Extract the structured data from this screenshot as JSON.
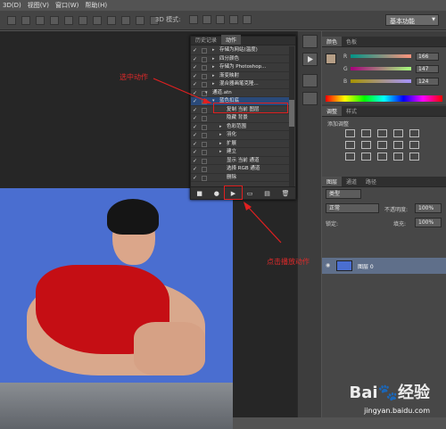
{
  "menubar": {
    "items": [
      "3D(D)",
      "视图(V)",
      "窗口(W)",
      "帮助(H)"
    ]
  },
  "options": {
    "mode_3d_label": "3D 模式:",
    "workspace": "基本功能"
  },
  "actions_panel": {
    "tabs": [
      "历史记录",
      "动作"
    ],
    "rows": [
      {
        "checked": "✓",
        "indent": 0,
        "expand": "▸",
        "label": "存储为网站(温度)"
      },
      {
        "checked": "✓",
        "indent": 0,
        "expand": "▸",
        "label": "四分颜色"
      },
      {
        "checked": "✓",
        "indent": 0,
        "expand": "▸",
        "label": "存储为 Photoshop..."
      },
      {
        "checked": "✓",
        "indent": 0,
        "expand": "▸",
        "label": "渐变映射"
      },
      {
        "checked": "✓",
        "indent": 0,
        "expand": "▸",
        "label": "混合器画笔克隆..."
      },
      {
        "checked": "✓",
        "indent": -1,
        "expand": "▾",
        "label": "通道.atn"
      },
      {
        "checked": "✓",
        "indent": 0,
        "expand": "▾",
        "label": "蓝色扣底"
      },
      {
        "checked": "✓",
        "indent": 1,
        "expand": "",
        "label": "复制 当前 图层"
      },
      {
        "checked": "✓",
        "indent": 1,
        "expand": "",
        "label": "隐藏 背景"
      },
      {
        "checked": "✓",
        "indent": 1,
        "expand": "▸",
        "label": "色彩范围"
      },
      {
        "checked": "✓",
        "indent": 1,
        "expand": "▸",
        "label": "羽化"
      },
      {
        "checked": "✓",
        "indent": 1,
        "expand": "▸",
        "label": "扩展"
      },
      {
        "checked": "✓",
        "indent": 1,
        "expand": "▸",
        "label": "建立"
      },
      {
        "checked": "✓",
        "indent": 1,
        "expand": "",
        "label": "显示 当前 通道"
      },
      {
        "checked": "✓",
        "indent": 1,
        "expand": "",
        "label": "选择 RGB 通道"
      },
      {
        "checked": "✓",
        "indent": 1,
        "expand": "",
        "label": "删除"
      }
    ],
    "footer_buttons": [
      "■",
      "●",
      "▶",
      "▭",
      "▤",
      "🗑"
    ]
  },
  "color_panel": {
    "tabs": [
      "颜色",
      "色板"
    ],
    "r_label": "R",
    "r_value": "166",
    "g_label": "G",
    "g_value": "147",
    "b_label": "B",
    "b_value": "124",
    "fg_color": "#b59e86"
  },
  "adjust_panel": {
    "tabs": [
      "调整",
      "样式"
    ],
    "title": "添加调整"
  },
  "layers_panel": {
    "tabs": [
      "图层",
      "通道",
      "路径"
    ],
    "filter": "类型",
    "blend_mode": "正常",
    "opacity_label": "不透明度:",
    "opacity_value": "100%",
    "lock_label": "锁定:",
    "fill_label": "填充:",
    "fill_value": "100%",
    "layer_name": "图层 0"
  },
  "annotations": {
    "select_action": "选中动作",
    "click_play": "点击播放动作"
  },
  "watermark": {
    "brand": "Bai🐾经验",
    "url": "jingyan.baidu.com"
  }
}
